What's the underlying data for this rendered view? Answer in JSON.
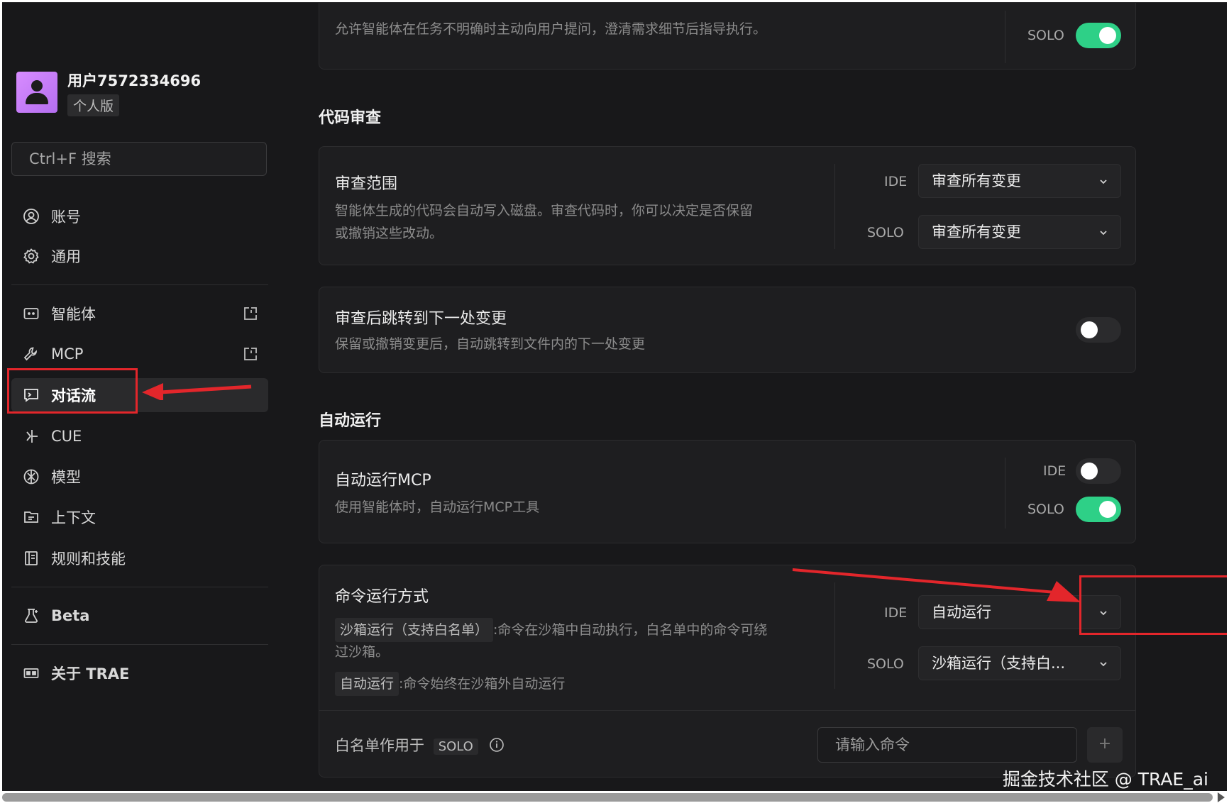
{
  "sidebar": {
    "username": "用户7572334696",
    "plan": "个人版",
    "search_placeholder": "Ctrl+F 搜索",
    "items": [
      {
        "label": "账号",
        "icon": "account-icon"
      },
      {
        "label": "通用",
        "icon": "gear-icon"
      },
      {
        "label": "智能体",
        "icon": "agent-icon",
        "external": true
      },
      {
        "label": "MCP",
        "icon": "wrench-icon",
        "external": true
      },
      {
        "label": "对话流",
        "icon": "chat-flow-icon",
        "active": true
      },
      {
        "label": "CUE",
        "icon": "cue-icon"
      },
      {
        "label": "模型",
        "icon": "model-icon"
      },
      {
        "label": "上下文",
        "icon": "context-icon"
      },
      {
        "label": "规则和技能",
        "icon": "rules-icon"
      },
      {
        "label": "Beta",
        "icon": "beta-flask-icon"
      },
      {
        "label": "关于 TRAE",
        "icon": "about-icon"
      }
    ]
  },
  "main": {
    "top_card": {
      "desc": "允许智能体在任务不明确时主动向用户提问，澄清需求细节后指导执行。",
      "solo_label": "SOLO",
      "solo_on": true
    },
    "section_review": "代码审查",
    "review_scope": {
      "title": "审查范围",
      "desc_line1": "智能体生成的代码会自动写入磁盘。审查代码时，你可以决定是否保留",
      "desc_line2": "或撤销这些改动。",
      "ide_label": "IDE",
      "ide_value": "审查所有变更",
      "solo_label": "SOLO",
      "solo_value": "审查所有变更"
    },
    "jump_next": {
      "title": "审查后跳转到下一处变更",
      "desc": "保留或撤销变更后，自动跳转到文件内的下一处变更",
      "on": false
    },
    "section_autorun": "自动运行",
    "autorun_mcp": {
      "title": "自动运行MCP",
      "desc": "使用智能体时，自动运行MCP工具",
      "ide_label": "IDE",
      "ide_on": false,
      "solo_label": "SOLO",
      "solo_on": true
    },
    "command_mode": {
      "title": "命令运行方式",
      "tag1": "沙箱运行（支持白名单）",
      "tag1_desc": ":命令在沙箱中自动执行，白名单中的命令可绕",
      "tag1_desc2": "过沙箱。",
      "tag2": "自动运行",
      "tag2_desc": ":命令始终在沙箱外自动运行",
      "ide_label": "IDE",
      "ide_value": "自动运行",
      "solo_label": "SOLO",
      "solo_value": "沙箱运行（支持白..."
    },
    "whitelist": {
      "label": "白名单作用于",
      "tag": "SOLO",
      "input_placeholder": "请输入命令",
      "add_label": "+"
    }
  },
  "watermark": "掘金技术社区 @ TRAE_ai",
  "colors": {
    "toggle_on": "#2ed087",
    "highlight": "#e3262b",
    "bg": "#18181a"
  }
}
